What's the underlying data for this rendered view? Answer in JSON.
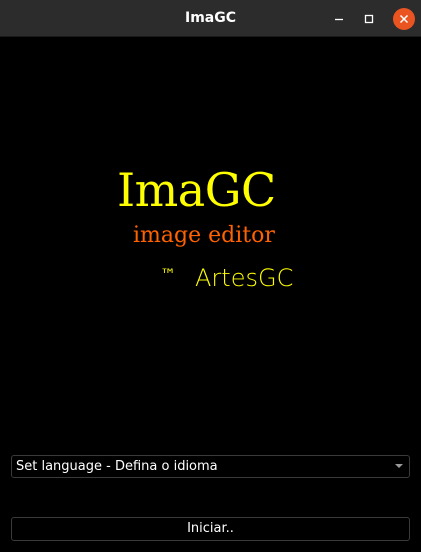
{
  "window": {
    "title": "ImaGC",
    "controls": {
      "minimize_icon": "minimize-icon",
      "maximize_icon": "maximize-icon",
      "close_icon": "close-icon",
      "close_color": "#e95420"
    }
  },
  "splash": {
    "app_name": "ImaGC",
    "subtitle": "image editor",
    "trademark": "™",
    "company": "ArtesGC",
    "colors": {
      "app_name": "#ffff00",
      "subtitle": "#ff6200",
      "company": "#ffff00",
      "background": "#000000"
    }
  },
  "language": {
    "selected": "Set language - Defina o idioma",
    "arrow_icon": "chevron-down-icon"
  },
  "start": {
    "label": "Iniciar.."
  }
}
